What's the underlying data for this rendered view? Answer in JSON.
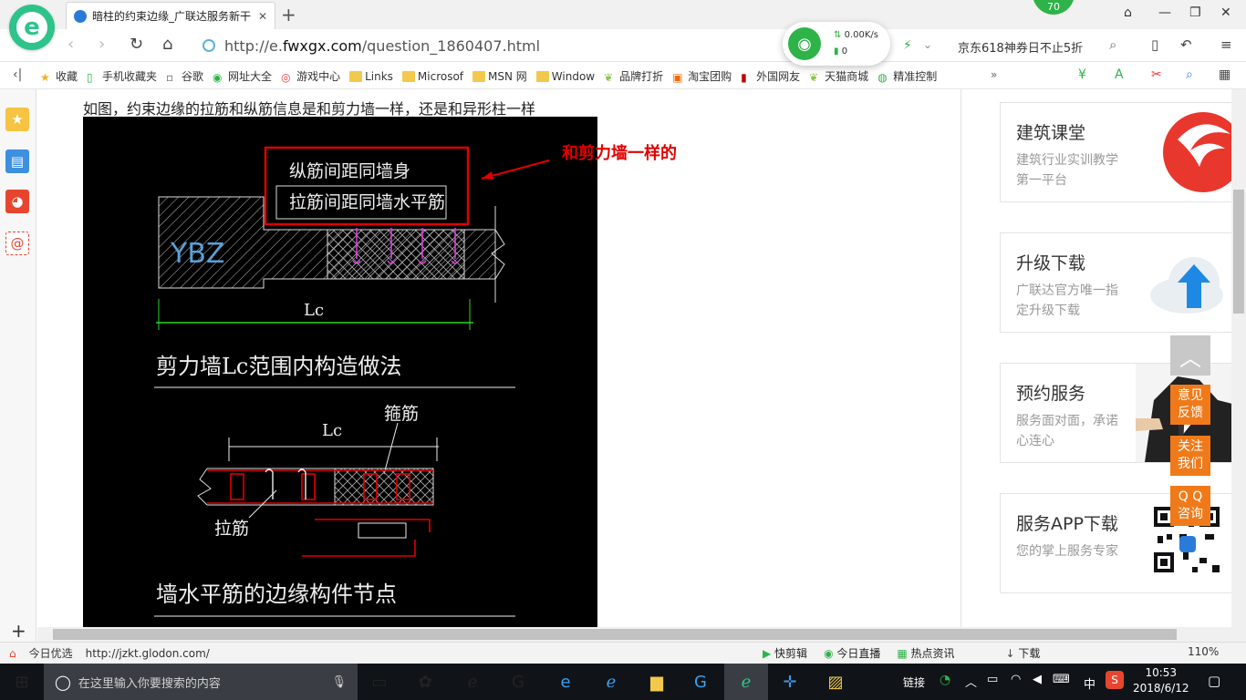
{
  "browser": {
    "tab_title": "暗柱的约束边缘_广联达服务新干",
    "badge_count": "70",
    "url_prefix": "http://e.",
    "url_host": "fwxgx.com",
    "url_path": "/question_1860407.html",
    "net_speed": "0.00K/s",
    "net_count": "0",
    "promo_text": "京东618神券日不止5折"
  },
  "bookmarks": [
    {
      "label": "收藏",
      "icon": "star-icon"
    },
    {
      "label": "手机收藏夹",
      "icon": "phone-icon"
    },
    {
      "label": "谷歌",
      "icon": "page-icon"
    },
    {
      "label": "网址大全",
      "icon": "globe-icon"
    },
    {
      "label": "游戏中心",
      "icon": "game-icon"
    },
    {
      "label": "Links",
      "icon": "folder-icon"
    },
    {
      "label": "Microsof",
      "icon": "folder-icon"
    },
    {
      "label": "MSN 网",
      "icon": "folder-icon"
    },
    {
      "label": "Window",
      "icon": "folder-icon"
    },
    {
      "label": "品牌打折",
      "icon": "leaf-icon"
    },
    {
      "label": "淘宝团购",
      "icon": "taobao-icon"
    },
    {
      "label": "外国网友",
      "icon": "bookmark-icon"
    },
    {
      "label": "天猫商城",
      "icon": "leaf-icon"
    },
    {
      "label": "精准控制",
      "icon": "wechat-icon"
    }
  ],
  "page": {
    "question": "如图，约束边缘的拉筋和纵筋信息是和剪力墙一样，还是和异形柱一样",
    "annotation": "和剪力墙一样的",
    "cad": {
      "box_line1": "纵筋间距同墙身",
      "box_line2": "拉筋间距同墙水平筋",
      "ybz": "YBZ",
      "lc_top": "Lc",
      "title1": "剪力墙Lc范围内构造做法",
      "lc_mid": "Lc",
      "gujin": "箍筋",
      "lajin": "拉筋",
      "title2": "墙水平筋的边缘构件节点"
    }
  },
  "sidebar_cards": [
    {
      "title": "建筑课堂",
      "desc": "建筑行业实训教学第一平台",
      "icon": "glodon-logo"
    },
    {
      "title": "升级下载",
      "desc": "广联达官方唯一指定升级下载",
      "icon": "cloud-upload-icon"
    },
    {
      "title": "预约服务",
      "desc": "服务面对面，承诺心连心",
      "icon": "person-photo"
    },
    {
      "title": "服务APP下载",
      "desc": "您的掌上服务专家",
      "icon": "qr-code"
    }
  ],
  "float_buttons": {
    "feedback": [
      "意见",
      "反馈"
    ],
    "follow": [
      "关注",
      "我们"
    ],
    "qq": [
      "Q Q",
      "咨询"
    ]
  },
  "statusbar": {
    "today": "今日优选",
    "link": "http://jzkt.glodon.com/",
    "items": [
      "快剪辑",
      "今日直播",
      "热点资讯",
      "下载"
    ],
    "zoom": "110%"
  },
  "taskbar": {
    "search_placeholder": "在这里输入你要搜索的内容",
    "link_label": "链接",
    "ime": "中",
    "time": "10:53",
    "date": "2018/6/12"
  }
}
